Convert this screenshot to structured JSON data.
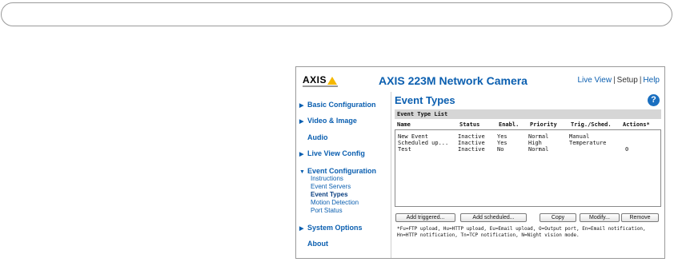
{
  "camera": {
    "logo": "AXIS",
    "title": "AXIS 223M Network Camera",
    "links": {
      "live_view": "Live View",
      "separator": "|",
      "setup": "Setup",
      "help": "Help"
    }
  },
  "sidebar": {
    "items": [
      {
        "label": "Basic Configuration",
        "arrow": "▶"
      },
      {
        "label": "Video & Image",
        "arrow": "▶"
      },
      {
        "label": "Audio",
        "arrow": ""
      },
      {
        "label": "Live View Config",
        "arrow": "▶"
      },
      {
        "label": "Event Configuration",
        "arrow": "▼"
      },
      {
        "label": "System Options",
        "arrow": "▶"
      },
      {
        "label": "About",
        "arrow": ""
      }
    ],
    "subitems": [
      "Instructions",
      "Event Servers",
      "Event Types",
      "Motion Detection",
      "Port Status"
    ]
  },
  "main": {
    "title": "Event Types",
    "help_symbol": "?",
    "section": "Event Type List",
    "columns": [
      "Name",
      "Status",
      "Enabl.",
      "Priority",
      "Trig./Sched.",
      "Actions*"
    ],
    "rows": [
      [
        "New Event",
        "Inactive",
        "Yes",
        "Normal",
        "Manual",
        ""
      ],
      [
        "Scheduled up...",
        "Inactive",
        "Yes",
        "High",
        "Temperature",
        ""
      ],
      [
        "Test",
        "Inactive",
        "No",
        "Normal",
        "",
        "0"
      ]
    ],
    "buttons": {
      "add_triggered": "Add triggered...",
      "add_scheduled": "Add scheduled...",
      "copy": "Copy",
      "modify": "Modify...",
      "remove": "Remove"
    },
    "footnote": "*Fu=FTP upload, Hu=HTTP upload, Eu=Email upload, O=Output port, En=Email notification, Hn=HTTP notification, Tn=TCP notification, N=Night vision mode."
  }
}
